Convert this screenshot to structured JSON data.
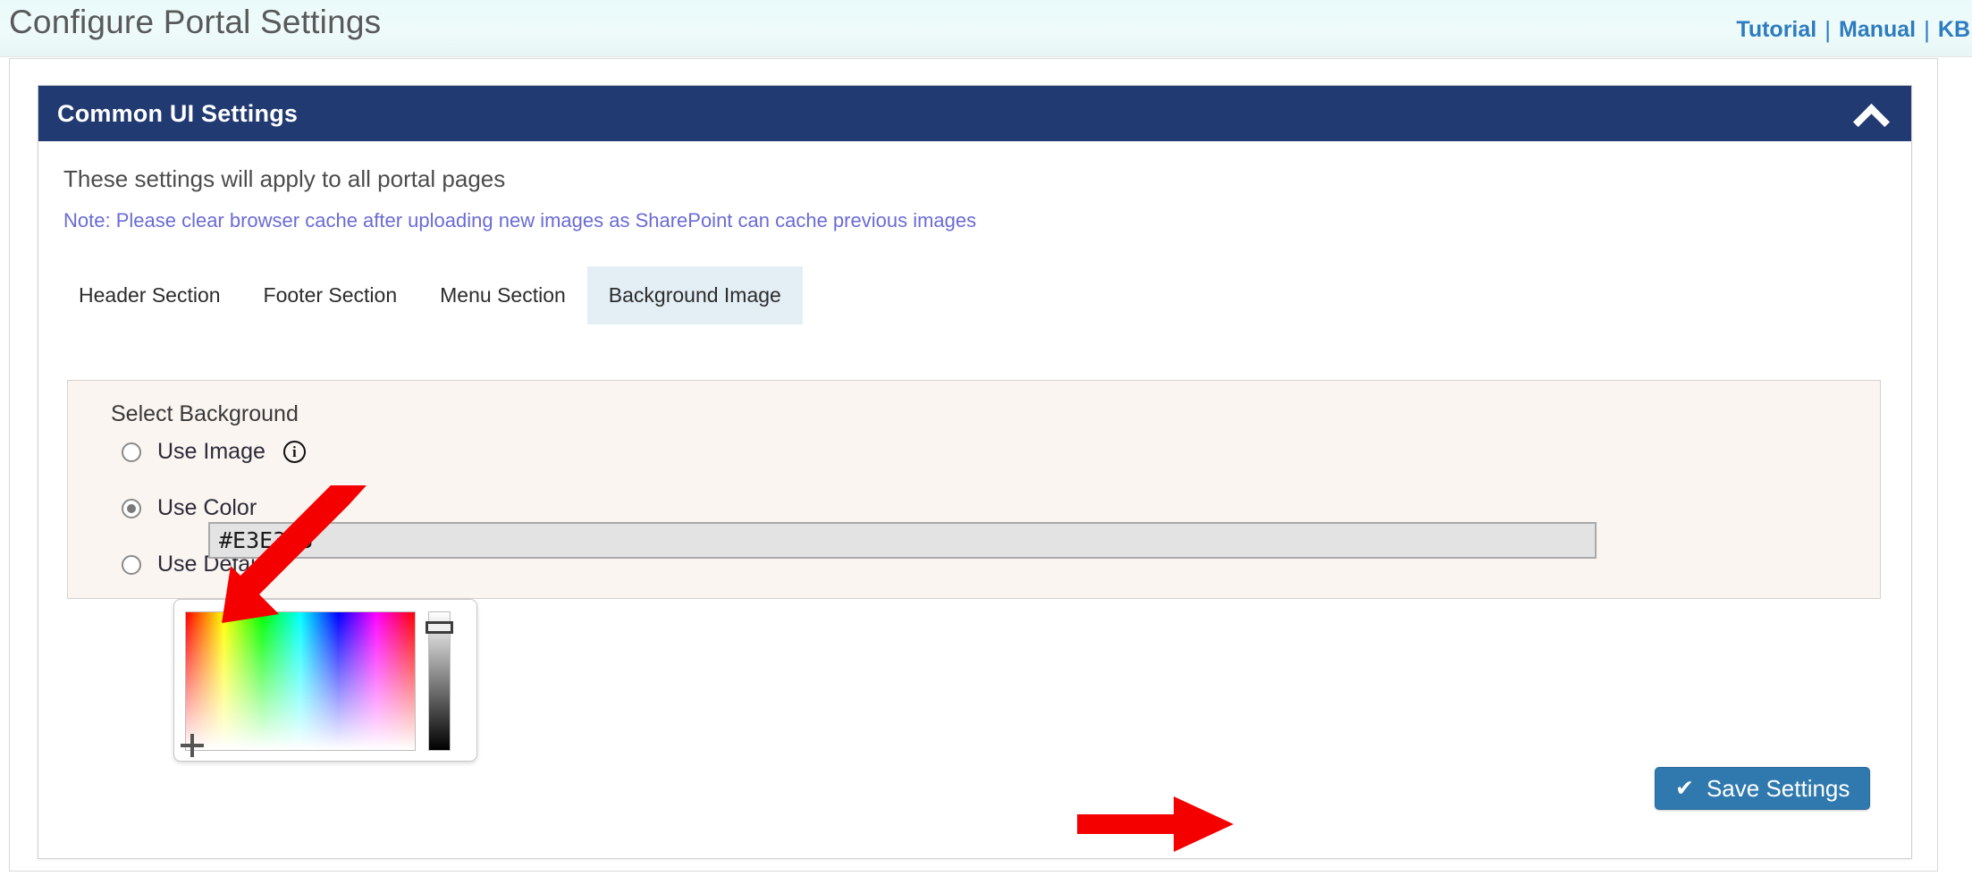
{
  "header": {
    "title": "Configure Portal Settings",
    "links": [
      {
        "label": "Tutorial"
      },
      {
        "label": "Manual"
      },
      {
        "label": "KB"
      }
    ],
    "separator": "|"
  },
  "panel": {
    "title": "Common UI Settings",
    "collapse_icon": "chevron-up-icon",
    "intro": "These settings will apply to all portal pages",
    "note": "Note: Please clear browser cache after uploading new images as SharePoint can cache previous images",
    "tabs": [
      {
        "label": "Header Section",
        "active": false
      },
      {
        "label": "Footer Section",
        "active": false
      },
      {
        "label": "Menu Section",
        "active": false
      },
      {
        "label": "Background Image",
        "active": true
      }
    ]
  },
  "background_section": {
    "title": "Select Background",
    "options": [
      {
        "label": "Use Image",
        "selected": false,
        "info_icon": "info-icon"
      },
      {
        "label": "Use Color",
        "selected": true
      },
      {
        "label": "Use Default",
        "selected": false
      }
    ],
    "color_input": {
      "value": "#E3E3E3",
      "placeholder": "#E3E3E3",
      "swatch_color": "#E3E3E3"
    },
    "color_picker": {
      "name": "color-picker-popup",
      "saturation_cursor": "crosshair-cursor",
      "brightness_slider": "brightness-slider",
      "brightness_handle": "brightness-handle"
    }
  },
  "footer": {
    "save_label": "Save Settings",
    "save_icon": "check-icon"
  },
  "annotations": [
    {
      "name": "arrow-to-color-input",
      "color": "#f40000",
      "direction": "down-left"
    },
    {
      "name": "arrow-to-save-button",
      "color": "#f40000",
      "direction": "right"
    }
  ],
  "colors": {
    "header_bg": "#EAFAFA",
    "link_blue": "#2E7CC0",
    "panel_head": "#223A72",
    "note_purple": "#6B6BD6",
    "active_tab": "#E3EEF5",
    "section_bg": "#FBF5F1",
    "save_blue": "#3079AE",
    "annotation_red": "#F40000"
  }
}
